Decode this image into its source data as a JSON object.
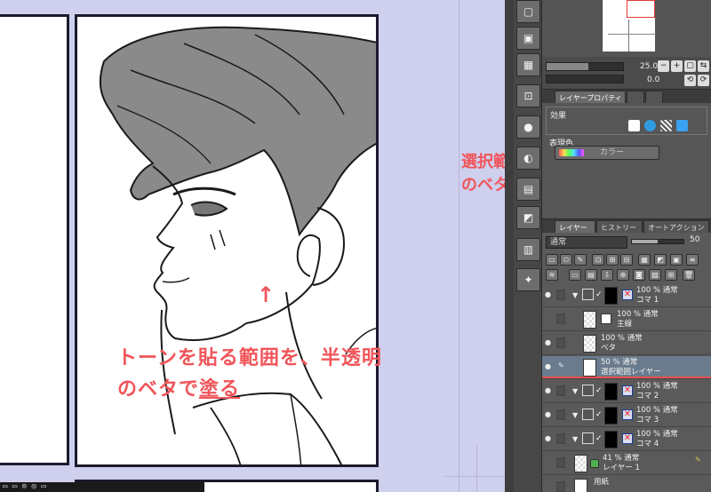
{
  "annotations": {
    "left_line1": "トーンを貼る範囲を、半透明",
    "left_line2_a": "のベタで",
    "left_line2_b": "塗る",
    "right_line1": "選択範囲レイヤーは半透明",
    "right_line2": "のベタにする",
    "arrow_up": "↑",
    "arrow_down": "↓"
  },
  "navigator": {
    "zoom_value": "25.0",
    "rotate_value": "0.0",
    "zoom_fill": 0.55
  },
  "property_tabs": [
    {
      "label": "レイヤープロパティ"
    },
    {
      "label": ""
    },
    {
      "label": ""
    }
  ],
  "layer_property": {
    "effect_label": "効果",
    "color_label": "表現色",
    "color_value": "カラー"
  },
  "layer_tabs": [
    {
      "label": "レイヤー"
    },
    {
      "label": "ヒストリー"
    },
    {
      "label": "オートアクション"
    }
  ],
  "layer_panel": {
    "blend_mode": "通常",
    "opacity": "50",
    "opacity_fill": 0.5
  },
  "layers": [
    {
      "line1": "100 % 通常",
      "line2": "コマ 1"
    },
    {
      "line1": "100 % 通常",
      "line2": "主線"
    },
    {
      "line1": "100 % 通常",
      "line2": "ベタ"
    },
    {
      "line1": "50 % 通常",
      "line2": "選択範囲レイヤー"
    },
    {
      "line1": "100 % 通常",
      "line2": "コマ 2"
    },
    {
      "line1": "100 % 通常",
      "line2": "コマ 3"
    },
    {
      "line1": "100 % 通常",
      "line2": "コマ 4"
    },
    {
      "line1": "41 % 通常",
      "line2": "レイヤー 1"
    },
    {
      "line1": "",
      "line2": "用紙"
    }
  ],
  "status_bar": {
    "text": "▭ ▭ ⊙ ◎ ▭"
  },
  "colors": {
    "annotation": "#f0555a",
    "canvas_bg": "#cfcfee",
    "panel_bg": "#5f5f5f",
    "selected_layer": "#6a7b8e"
  }
}
